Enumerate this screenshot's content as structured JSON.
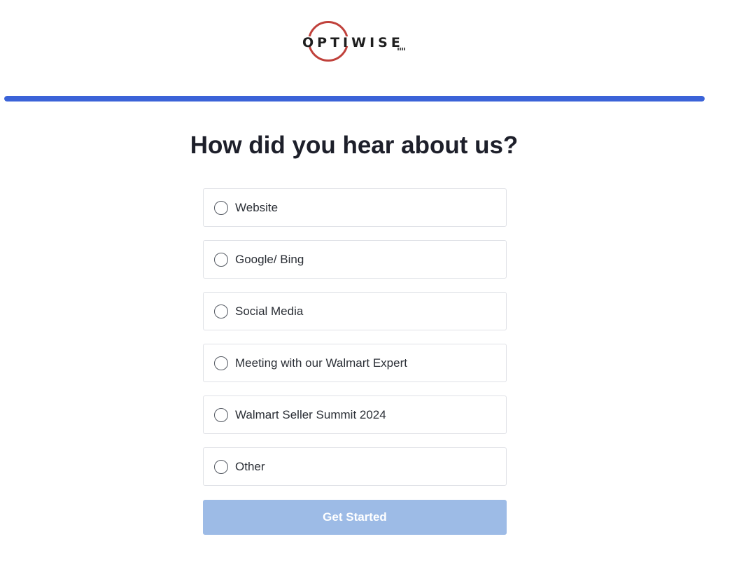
{
  "brand": {
    "logo_text": "OPTIWISE",
    "logo_icon": "optiwise-logo",
    "ring_color": "#c0413b"
  },
  "progress": {
    "value": 1.0,
    "fill_color": "#3b63d8"
  },
  "question": {
    "title": "How did you hear about us?"
  },
  "options": [
    {
      "label": "Website",
      "selected": false
    },
    {
      "label": "Google/ Bing",
      "selected": false
    },
    {
      "label": "Social Media",
      "selected": false
    },
    {
      "label": "Meeting with our Walmart Expert",
      "selected": false
    },
    {
      "label": "Walmart Seller Summit 2024",
      "selected": false
    },
    {
      "label": "Other",
      "selected": false
    }
  ],
  "actions": {
    "submit_label": "Get Started",
    "submit_color": "#9dbbe6"
  }
}
